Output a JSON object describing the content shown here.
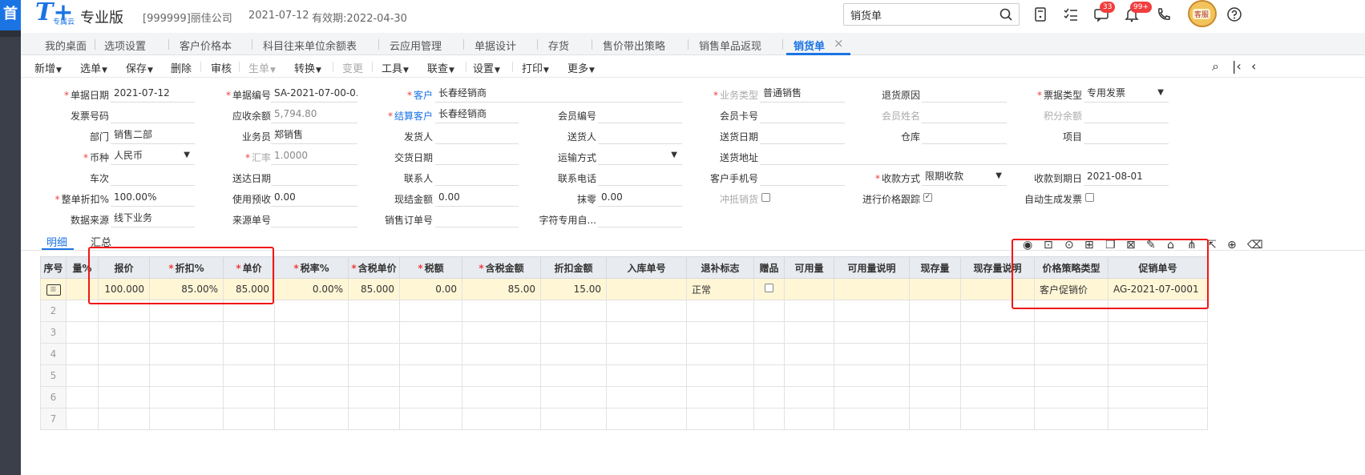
{
  "header": {
    "logo_text": "T+",
    "logo_sub": "专属云",
    "edition": "专业版",
    "company": "[999999]丽佳公司",
    "date": "2021-07-12",
    "expire": "有效期:2022-04-30",
    "search_value": "销货单",
    "badges": {
      "messages": "33",
      "notices": "99+"
    },
    "avatar_label": "客服",
    "left_char": "首"
  },
  "tabs": [
    {
      "label": "我的桌面"
    },
    {
      "label": "选项设置"
    },
    {
      "label": "客户价格本"
    },
    {
      "label": "科目往来单位余额表"
    },
    {
      "label": "云应用管理"
    },
    {
      "label": "单据设计"
    },
    {
      "label": "存货"
    },
    {
      "label": "售价带出策略"
    },
    {
      "label": "销售单品返现"
    },
    {
      "label": "销货单"
    }
  ],
  "toolbar": {
    "new": "新增",
    "select": "选单",
    "save": "保存",
    "delete": "删除",
    "audit": "审核",
    "generate": "生单",
    "convert": "转换",
    "change": "变更",
    "tools": "工具",
    "lookup": "联查",
    "settings": "设置",
    "print": "打印",
    "more": "更多"
  },
  "form": {
    "doc_date": {
      "label": "单据日期",
      "value": "2021-07-12"
    },
    "doc_no": {
      "label": "单据编号",
      "value": "SA-2021-07-00-0..."
    },
    "customer": {
      "label": "客户",
      "value": "长春经销商"
    },
    "biz_type": {
      "label": "业务类型",
      "value": "普通销售"
    },
    "return_reason": {
      "label": "退货原因",
      "value": ""
    },
    "invoice_type": {
      "label": "票据类型",
      "value": "专用发票"
    },
    "invoice_no": {
      "label": "发票号码",
      "value": ""
    },
    "receivable": {
      "label": "应收余额",
      "value": "5,794.80"
    },
    "settle_customer": {
      "label": "结算客户",
      "value": "长春经销商"
    },
    "member_no": {
      "label": "会员编号",
      "value": ""
    },
    "member_card": {
      "label": "会员卡号",
      "value": ""
    },
    "member_name": {
      "label": "会员姓名",
      "value": ""
    },
    "points_balance": {
      "label": "积分余额",
      "value": ""
    },
    "department": {
      "label": "部门",
      "value": "销售二部"
    },
    "salesman": {
      "label": "业务员",
      "value": "郑销售"
    },
    "shipper": {
      "label": "发货人",
      "value": ""
    },
    "deliverer": {
      "label": "送货人",
      "value": ""
    },
    "delivery_date": {
      "label": "送货日期",
      "value": ""
    },
    "warehouse": {
      "label": "仓库",
      "value": ""
    },
    "project": {
      "label": "项目",
      "value": ""
    },
    "currency": {
      "label": "币种",
      "value": "人民币"
    },
    "exchange_rate": {
      "label": "汇率",
      "value": "1.0000"
    },
    "handover_date": {
      "label": "交货日期",
      "value": ""
    },
    "transport": {
      "label": "运输方式",
      "value": ""
    },
    "delivery_address": {
      "label": "送货地址",
      "value": ""
    },
    "vehicle_no": {
      "label": "车次",
      "value": ""
    },
    "arrival_date": {
      "label": "送达日期",
      "value": ""
    },
    "contact": {
      "label": "联系人",
      "value": ""
    },
    "contact_phone": {
      "label": "联系电话",
      "value": ""
    },
    "customer_mobile": {
      "label": "客户手机号",
      "value": ""
    },
    "payment_method": {
      "label": "收款方式",
      "value": "限期收款"
    },
    "due_date": {
      "label": "收款到期日",
      "value": "2021-08-01"
    },
    "whole_discount": {
      "label": "整单折扣%",
      "value": "100.00%"
    },
    "use_advance": {
      "label": "使用预收",
      "value": "0.00"
    },
    "cash_amount": {
      "label": "现结金额",
      "value": "0.00"
    },
    "rounding": {
      "label": "抹零",
      "value": "0.00"
    },
    "offset_sales": {
      "label": "冲抵销货",
      "checked": false
    },
    "price_tracking": {
      "label": "进行价格跟踪",
      "checked": true
    },
    "auto_invoice": {
      "label": "自动生成发票",
      "checked": false
    },
    "data_source": {
      "label": "数据来源",
      "value": "线下业务"
    },
    "source_no": {
      "label": "来源单号",
      "value": ""
    },
    "sales_order_no": {
      "label": "销售订单号",
      "value": ""
    },
    "special_char": {
      "label": "字符专用自...",
      "value": ""
    }
  },
  "detail_tabs": [
    {
      "label": "明细"
    },
    {
      "label": "汇总"
    }
  ],
  "grid": {
    "columns": [
      "序号",
      "量%",
      "报价",
      "折扣%",
      "单价",
      "税率%",
      "含税单价",
      "税额",
      "含税金额",
      "折扣金额",
      "入库单号",
      "退补标志",
      "赠品",
      "可用量",
      "可用量说明",
      "现存量",
      "现存量说明",
      "价格策略类型",
      "促销单号"
    ],
    "rows": [
      {
        "idx": "",
        "c1": "",
        "quote": "100.000",
        "discount": "85.00%",
        "price": "85.000",
        "tax_rate": "0.00%",
        "tax_price": "85.000",
        "tax": "0.00",
        "tax_amount": "85.00",
        "discount_amount": "15.00",
        "in_no": "",
        "flag": "正常",
        "gift": false,
        "avail": "",
        "avail_note": "",
        "stock": "",
        "stock_note": "",
        "strategy": "客户促销价",
        "promo_no": "AG-2021-07-0001"
      },
      {
        "idx": "2"
      },
      {
        "idx": "3"
      },
      {
        "idx": "4"
      },
      {
        "idx": "5"
      },
      {
        "idx": "6"
      },
      {
        "idx": "7"
      }
    ]
  },
  "colors": {
    "accent": "#1b74e4",
    "highlight_box": "#f01616",
    "selected_row": "#fff6d6"
  }
}
